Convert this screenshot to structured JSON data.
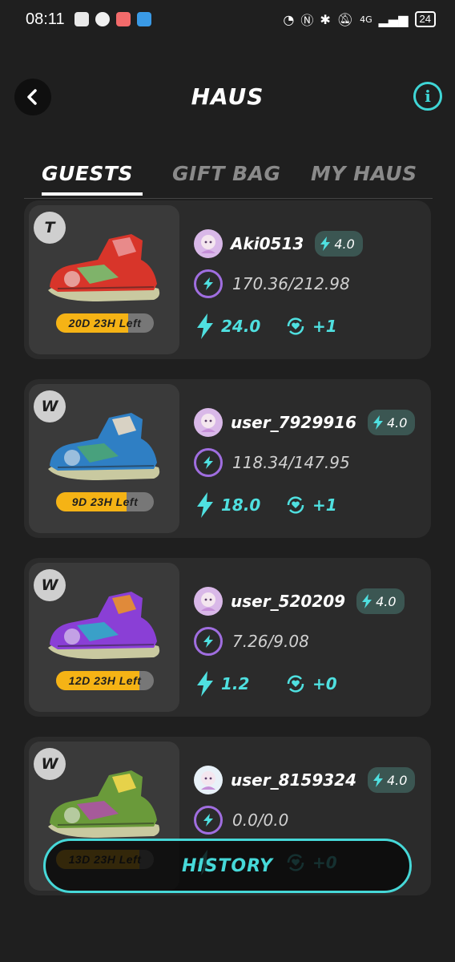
{
  "status_bar": {
    "time": "08:11",
    "network": "4G",
    "battery": "24"
  },
  "header": {
    "title": "HAUS"
  },
  "tabs": [
    {
      "label": "GUESTS",
      "active": true
    },
    {
      "label": "GIFT BAG",
      "active": false
    },
    {
      "label": "MY HAUS",
      "active": false
    }
  ],
  "guests": [
    {
      "badge": "T",
      "time_left": "20D 23H Left",
      "time_fill_fraction": 0.74,
      "username": "Aki0513",
      "level": "4.0",
      "energy": "170.36/212.98",
      "bolt_value": "24.0",
      "heart_value": "+1",
      "shoe_colors": [
        "#d8352a",
        "#7fb36a",
        "#e88a8a"
      ]
    },
    {
      "badge": "W",
      "time_left": "9D 23H Left",
      "time_fill_fraction": 0.72,
      "username": "user_7929916",
      "level": "4.0",
      "energy": "118.34/147.95",
      "bolt_value": "18.0",
      "heart_value": "+1",
      "shoe_colors": [
        "#2f7fc4",
        "#48a17d",
        "#d8d2c4"
      ]
    },
    {
      "badge": "W",
      "time_left": "12D 23H Left",
      "time_fill_fraction": 0.85,
      "username": "user_520209",
      "level": "4.0",
      "energy": "7.26/9.08",
      "bolt_value": "1.2",
      "heart_value": "+0",
      "shoe_colors": [
        "#8a3fd6",
        "#3aa0c8",
        "#e08a3a"
      ]
    },
    {
      "badge": "W",
      "time_left": "13D 23H Left",
      "time_fill_fraction": 0.85,
      "username": "user_8159324",
      "level": "4.0",
      "energy": "0.0/0.0",
      "bolt_value": "",
      "heart_value": "+0",
      "shoe_colors": [
        "#6a9a3a",
        "#a65a9a",
        "#e6d24a"
      ]
    }
  ],
  "history": {
    "label": "HISTORY"
  },
  "colors": {
    "accent": "#46d8d8",
    "timer": "#f5b315",
    "energy_ring": "#a06ee0",
    "level_bg": "#3b5652"
  }
}
